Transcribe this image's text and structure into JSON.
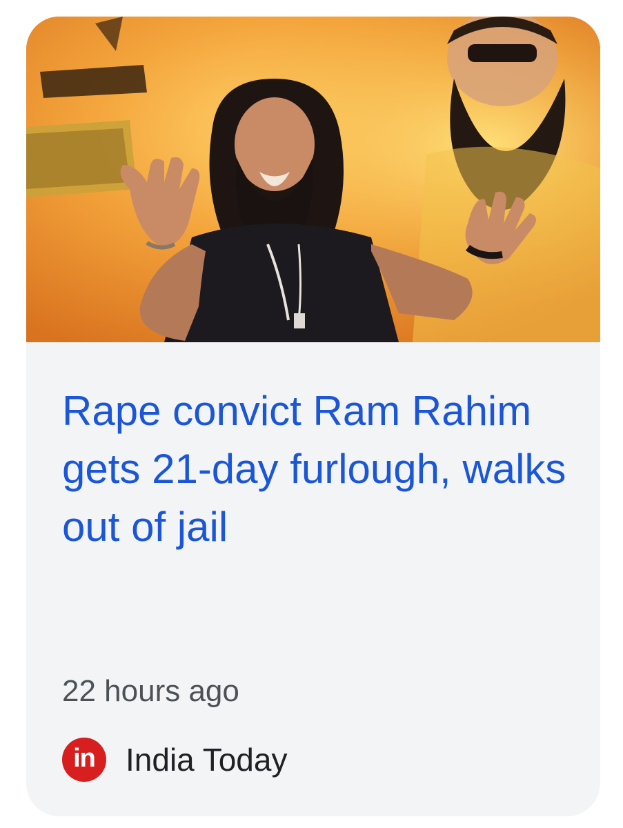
{
  "card": {
    "image_alt": "Man with long beard raising both hands in front of an orange poster",
    "headline": "Rape convict Ram Rahim gets 21-day furlough, walks out of jail",
    "time_ago": "22 hours ago",
    "source": {
      "logo_text": "in",
      "name": "India Today",
      "logo_color": "#d71f1f"
    }
  },
  "colors": {
    "headline": "#1a56d6",
    "card_background": "#f3f4f6",
    "meta_text": "#4d5156"
  }
}
